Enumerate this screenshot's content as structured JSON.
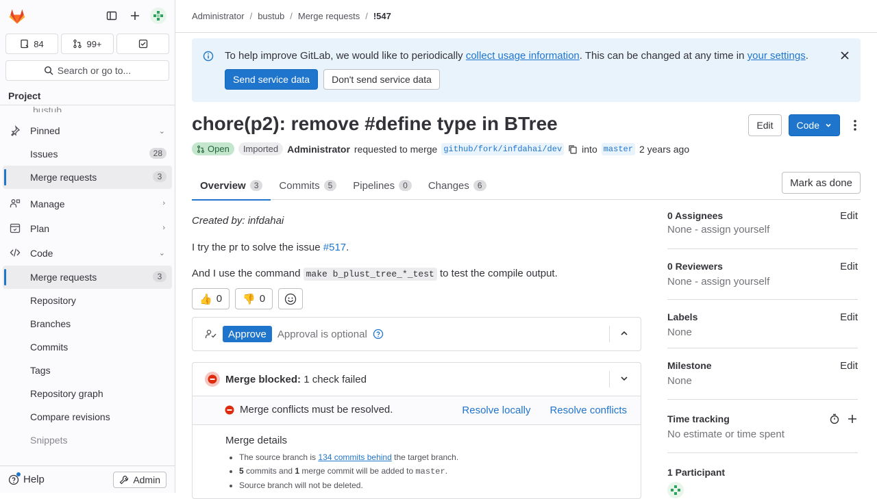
{
  "sidebar": {
    "counts": [
      {
        "icon": "issues-icon",
        "value": "84"
      },
      {
        "icon": "merge-request-icon",
        "value": "99+"
      },
      {
        "icon": "todo-icon",
        "value": ""
      }
    ],
    "search_label": "Search or go to...",
    "project_heading": "Project",
    "faded_item": "bustub",
    "pinned": {
      "label": "Pinned",
      "items": [
        {
          "label": "Issues",
          "count": "28"
        },
        {
          "label": "Merge requests",
          "count": "3"
        }
      ]
    },
    "sections": [
      {
        "label": "Manage",
        "icon": "users-icon"
      },
      {
        "label": "Plan",
        "icon": "calendar-icon"
      },
      {
        "label": "Code",
        "icon": "code-icon"
      }
    ],
    "code_items": [
      {
        "label": "Merge requests",
        "count": "3"
      },
      {
        "label": "Repository"
      },
      {
        "label": "Branches"
      },
      {
        "label": "Commits"
      },
      {
        "label": "Tags"
      },
      {
        "label": "Repository graph"
      },
      {
        "label": "Compare revisions"
      },
      {
        "label": "Snippets"
      }
    ],
    "help_label": "Help",
    "admin_label": "Admin"
  },
  "breadcrumb": [
    "Administrator",
    "bustub",
    "Merge requests",
    "!547"
  ],
  "banner": {
    "text_before": "To help improve GitLab, we would like to periodically ",
    "link1": "collect usage information",
    "text_middle": ". This can be changed at any time in ",
    "link2": "your settings",
    "text_after": ".",
    "send_label": "Send service data",
    "dont_send_label": "Don't send service data"
  },
  "mr": {
    "title": "chore(p2): remove #define type in BTree",
    "edit_label": "Edit",
    "code_label": "Code",
    "status": "Open",
    "imported": "Imported",
    "author": "Administrator",
    "requested_text": "requested to merge",
    "source_branch": "github/fork/infdahai/dev",
    "into_text": "into",
    "target_branch": "master",
    "time_ago": "2 years ago"
  },
  "tabs": [
    {
      "label": "Overview",
      "count": "3"
    },
    {
      "label": "Commits",
      "count": "5"
    },
    {
      "label": "Pipelines",
      "count": "0"
    },
    {
      "label": "Changes",
      "count": "6"
    }
  ],
  "mark_done_label": "Mark as done",
  "description": {
    "created_by": "Created by: infdahai",
    "line1_before": "I try the pr to solve the issue ",
    "line1_link": "#517",
    "line1_after": ".",
    "line2_before": "And I use the command ",
    "line2_code": "make b_plust_tree_*_test",
    "line2_after": " to test the compile output."
  },
  "reactions": [
    {
      "emoji": "👍",
      "count": "0"
    },
    {
      "emoji": "👎",
      "count": "0"
    }
  ],
  "approval": {
    "button": "Approve",
    "text": "Approval is optional"
  },
  "merge": {
    "blocked_label": "Merge blocked:",
    "blocked_detail": "1 check failed",
    "conflict_text": "Merge conflicts must be resolved.",
    "resolve_locally": "Resolve locally",
    "resolve_conflicts": "Resolve conflicts",
    "details_heading": "Merge details",
    "d1_before": "The source branch is ",
    "d1_link": "134 commits behind",
    "d1_after": " the target branch.",
    "d2_n1": "5",
    "d2_mid": " commits and ",
    "d2_n2": "1",
    "d2_after": " merge commit will be added to ",
    "d2_branch": "master",
    "d2_end": ".",
    "d3": "Source branch will not be deleted."
  },
  "right": {
    "assignees": {
      "heading": "0 Assignees",
      "value": "None - assign yourself",
      "edit": "Edit"
    },
    "reviewers": {
      "heading": "0 Reviewers",
      "value": "None - assign yourself",
      "edit": "Edit"
    },
    "labels": {
      "heading": "Labels",
      "value": "None",
      "edit": "Edit"
    },
    "milestone": {
      "heading": "Milestone",
      "value": "None",
      "edit": "Edit"
    },
    "time": {
      "heading": "Time tracking",
      "value": "No estimate or time spent"
    },
    "participants": {
      "heading": "1 Participant"
    }
  },
  "colors": {
    "accent": "#1f75cb",
    "danger": "#dd2b0e",
    "success": "#24663b"
  }
}
